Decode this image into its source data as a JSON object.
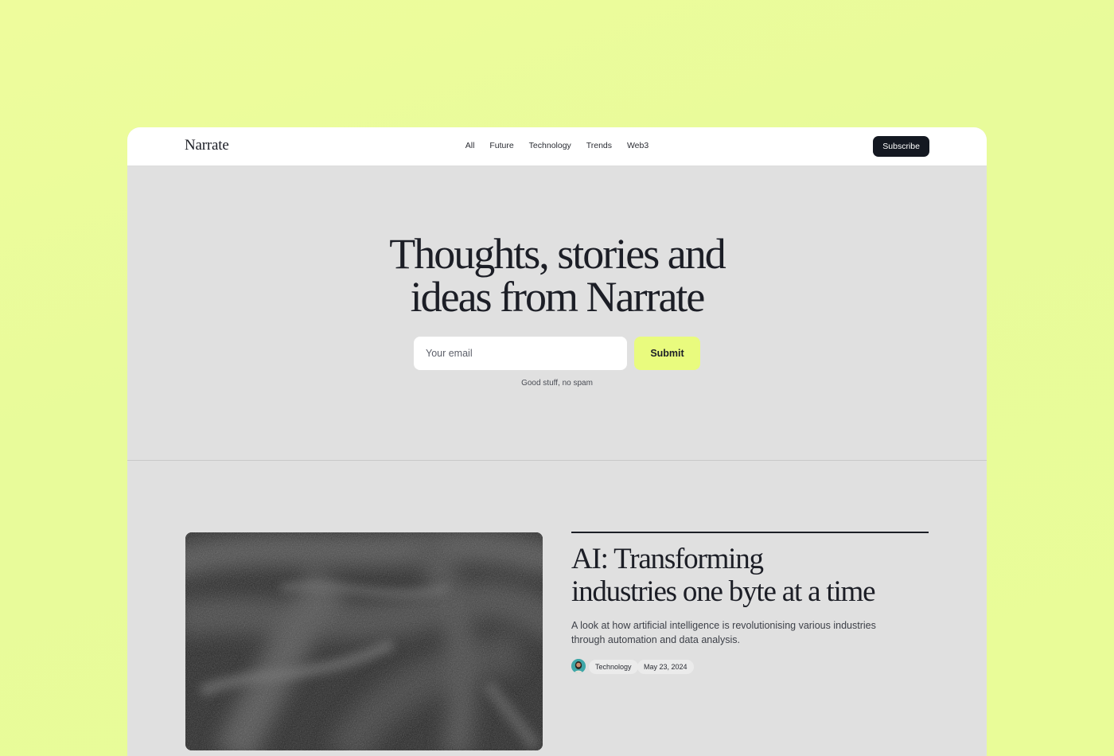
{
  "header": {
    "logo": "Narrate",
    "nav": [
      "All",
      "Future",
      "Technology",
      "Trends",
      "Web3"
    ],
    "subscribe_label": "Subscribe"
  },
  "hero": {
    "title_lines": [
      "Thoughts, stories and",
      "ideas from Narrate"
    ],
    "email_placeholder": "Your email",
    "submit_label": "Submit",
    "note": "Good stuff, no spam"
  },
  "featured_post": {
    "title_lines": [
      "AI: Transforming",
      "industries one byte at a time"
    ],
    "excerpt": "A look at how artificial intelligence is revolutionising various industries through automation and data analysis.",
    "category": "Technology",
    "date": "May 23, 2024"
  },
  "colors": {
    "background": "#e8fb9a",
    "accent": "#e9fb7e",
    "dark": "#141821",
    "surface": "#e0e0e0"
  }
}
